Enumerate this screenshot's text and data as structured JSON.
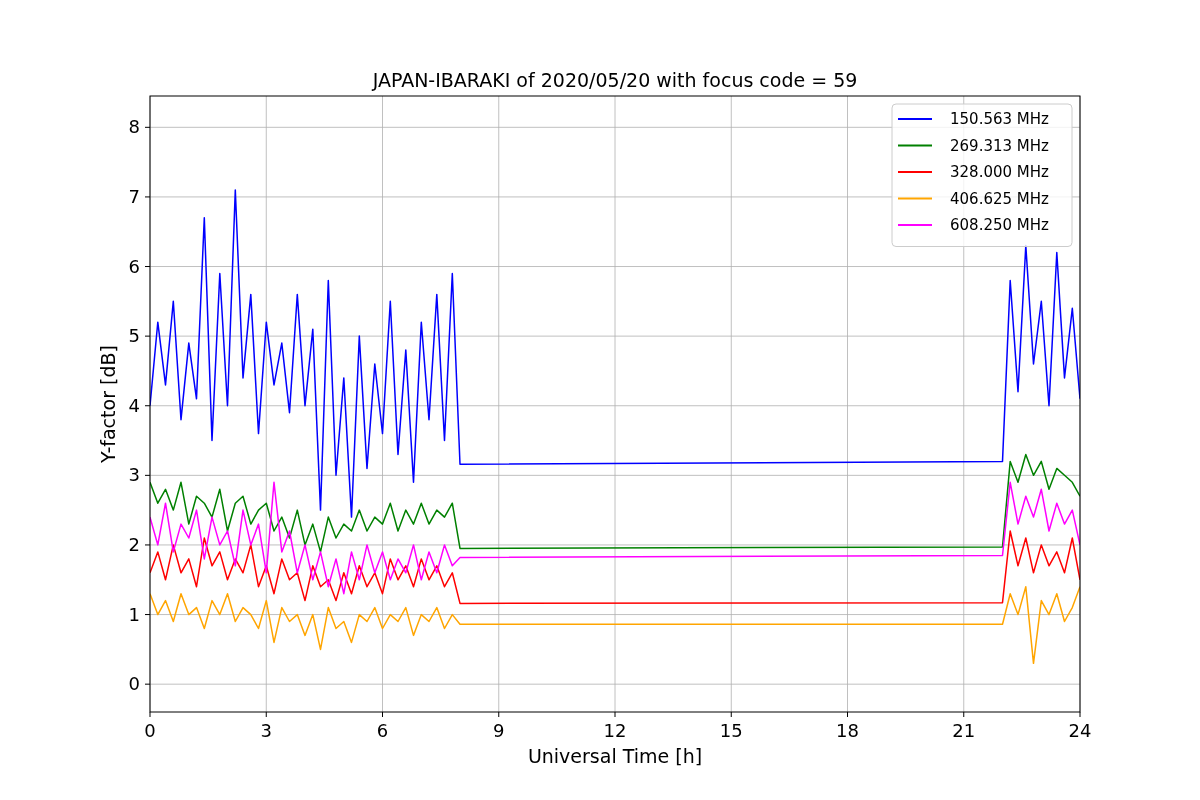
{
  "figure": {
    "chart_data": {
      "type": "line",
      "title": "JAPAN-IBARAKI of 2020/05/20 with focus code = 59",
      "xlabel": "Universal Time [h]",
      "ylabel": "Y-factor [dB]",
      "x": [
        0,
        0.2,
        0.4,
        0.6,
        0.8,
        1,
        1.2,
        1.4,
        1.6,
        1.8,
        2,
        2.2,
        2.4,
        2.6,
        2.8,
        3,
        3.2,
        3.4,
        3.6,
        3.8,
        4,
        4.2,
        4.4,
        4.6,
        4.8,
        5,
        5.2,
        5.4,
        5.6,
        5.8,
        6,
        6.2,
        6.4,
        6.6,
        6.8,
        7,
        7.2,
        7.4,
        7.6,
        7.8,
        8,
        22,
        22.2,
        22.4,
        22.6,
        22.8,
        23,
        23.2,
        23.4,
        23.6,
        23.8,
        24
      ],
      "xlim": [
        0,
        24
      ],
      "ylim": [
        -0.4,
        8.45
      ],
      "grid": true,
      "legend": true,
      "xticks": [
        0,
        3,
        6,
        9,
        12,
        15,
        18,
        21,
        24
      ],
      "yticks": [
        0,
        1,
        2,
        3,
        4,
        5,
        6,
        7,
        8
      ],
      "series": [
        {
          "name": "150.563 MHz",
          "color": "#0000ff",
          "values": [
            4.0,
            5.2,
            4.3,
            5.5,
            3.8,
            4.9,
            4.1,
            6.7,
            3.5,
            5.9,
            4.0,
            7.1,
            4.4,
            5.6,
            3.6,
            5.2,
            4.3,
            4.9,
            3.9,
            5.6,
            4.0,
            5.1,
            2.5,
            5.8,
            3.0,
            4.4,
            2.4,
            5.0,
            3.1,
            4.6,
            3.6,
            5.5,
            3.3,
            4.8,
            2.9,
            5.2,
            3.8,
            5.6,
            3.5,
            5.9,
            3.16,
            3.2,
            5.8,
            4.2,
            6.3,
            4.6,
            5.5,
            4.0,
            6.2,
            4.4,
            5.4,
            4.1
          ]
        },
        {
          "name": "269.313 MHz",
          "color": "#008000",
          "values": [
            2.9,
            2.6,
            2.8,
            2.5,
            2.9,
            2.3,
            2.7,
            2.6,
            2.4,
            2.8,
            2.2,
            2.6,
            2.7,
            2.3,
            2.5,
            2.6,
            2.2,
            2.4,
            2.1,
            2.5,
            2.0,
            2.3,
            1.9,
            2.4,
            2.1,
            2.3,
            2.2,
            2.5,
            2.2,
            2.4,
            2.3,
            2.6,
            2.2,
            2.5,
            2.3,
            2.6,
            2.3,
            2.5,
            2.4,
            2.6,
            1.95,
            1.97,
            3.2,
            2.9,
            3.3,
            3.0,
            3.2,
            2.8,
            3.1,
            3.0,
            2.9,
            2.7
          ]
        },
        {
          "name": "328.000 MHz",
          "color": "#ff0000",
          "values": [
            1.6,
            1.9,
            1.5,
            2.0,
            1.6,
            1.8,
            1.4,
            2.1,
            1.7,
            1.9,
            1.5,
            1.8,
            1.6,
            2.0,
            1.4,
            1.7,
            1.3,
            1.8,
            1.5,
            1.6,
            1.2,
            1.7,
            1.4,
            1.5,
            1.2,
            1.6,
            1.3,
            1.7,
            1.4,
            1.6,
            1.3,
            1.8,
            1.5,
            1.7,
            1.4,
            1.8,
            1.5,
            1.7,
            1.4,
            1.6,
            1.16,
            1.17,
            2.2,
            1.7,
            2.1,
            1.6,
            2.0,
            1.7,
            1.9,
            1.6,
            2.1,
            1.5
          ]
        },
        {
          "name": "406.625 MHz",
          "color": "#ffa500",
          "values": [
            1.3,
            1.0,
            1.2,
            0.9,
            1.3,
            1.0,
            1.1,
            0.8,
            1.2,
            1.0,
            1.3,
            0.9,
            1.1,
            1.0,
            0.8,
            1.2,
            0.6,
            1.1,
            0.9,
            1.0,
            0.7,
            1.0,
            0.5,
            1.1,
            0.8,
            0.9,
            0.6,
            1.0,
            0.9,
            1.1,
            0.8,
            1.0,
            0.9,
            1.1,
            0.7,
            1.0,
            0.9,
            1.1,
            0.8,
            1.0,
            0.86,
            0.86,
            1.3,
            1.0,
            1.4,
            0.3,
            1.2,
            1.0,
            1.3,
            0.9,
            1.1,
            1.4
          ]
        },
        {
          "name": "608.250 MHz",
          "color": "#ff00ff",
          "values": [
            2.4,
            2.0,
            2.6,
            1.9,
            2.3,
            2.1,
            2.5,
            1.8,
            2.4,
            2.0,
            2.2,
            1.7,
            2.5,
            2.0,
            2.3,
            1.6,
            2.9,
            1.9,
            2.2,
            1.6,
            2.0,
            1.5,
            1.9,
            1.4,
            1.8,
            1.3,
            1.9,
            1.5,
            2.0,
            1.6,
            1.9,
            1.5,
            1.8,
            1.6,
            2.0,
            1.5,
            1.9,
            1.6,
            2.0,
            1.7,
            1.82,
            1.85,
            2.9,
            2.3,
            2.7,
            2.4,
            2.8,
            2.2,
            2.6,
            2.3,
            2.5,
            2.0
          ]
        }
      ]
    }
  }
}
